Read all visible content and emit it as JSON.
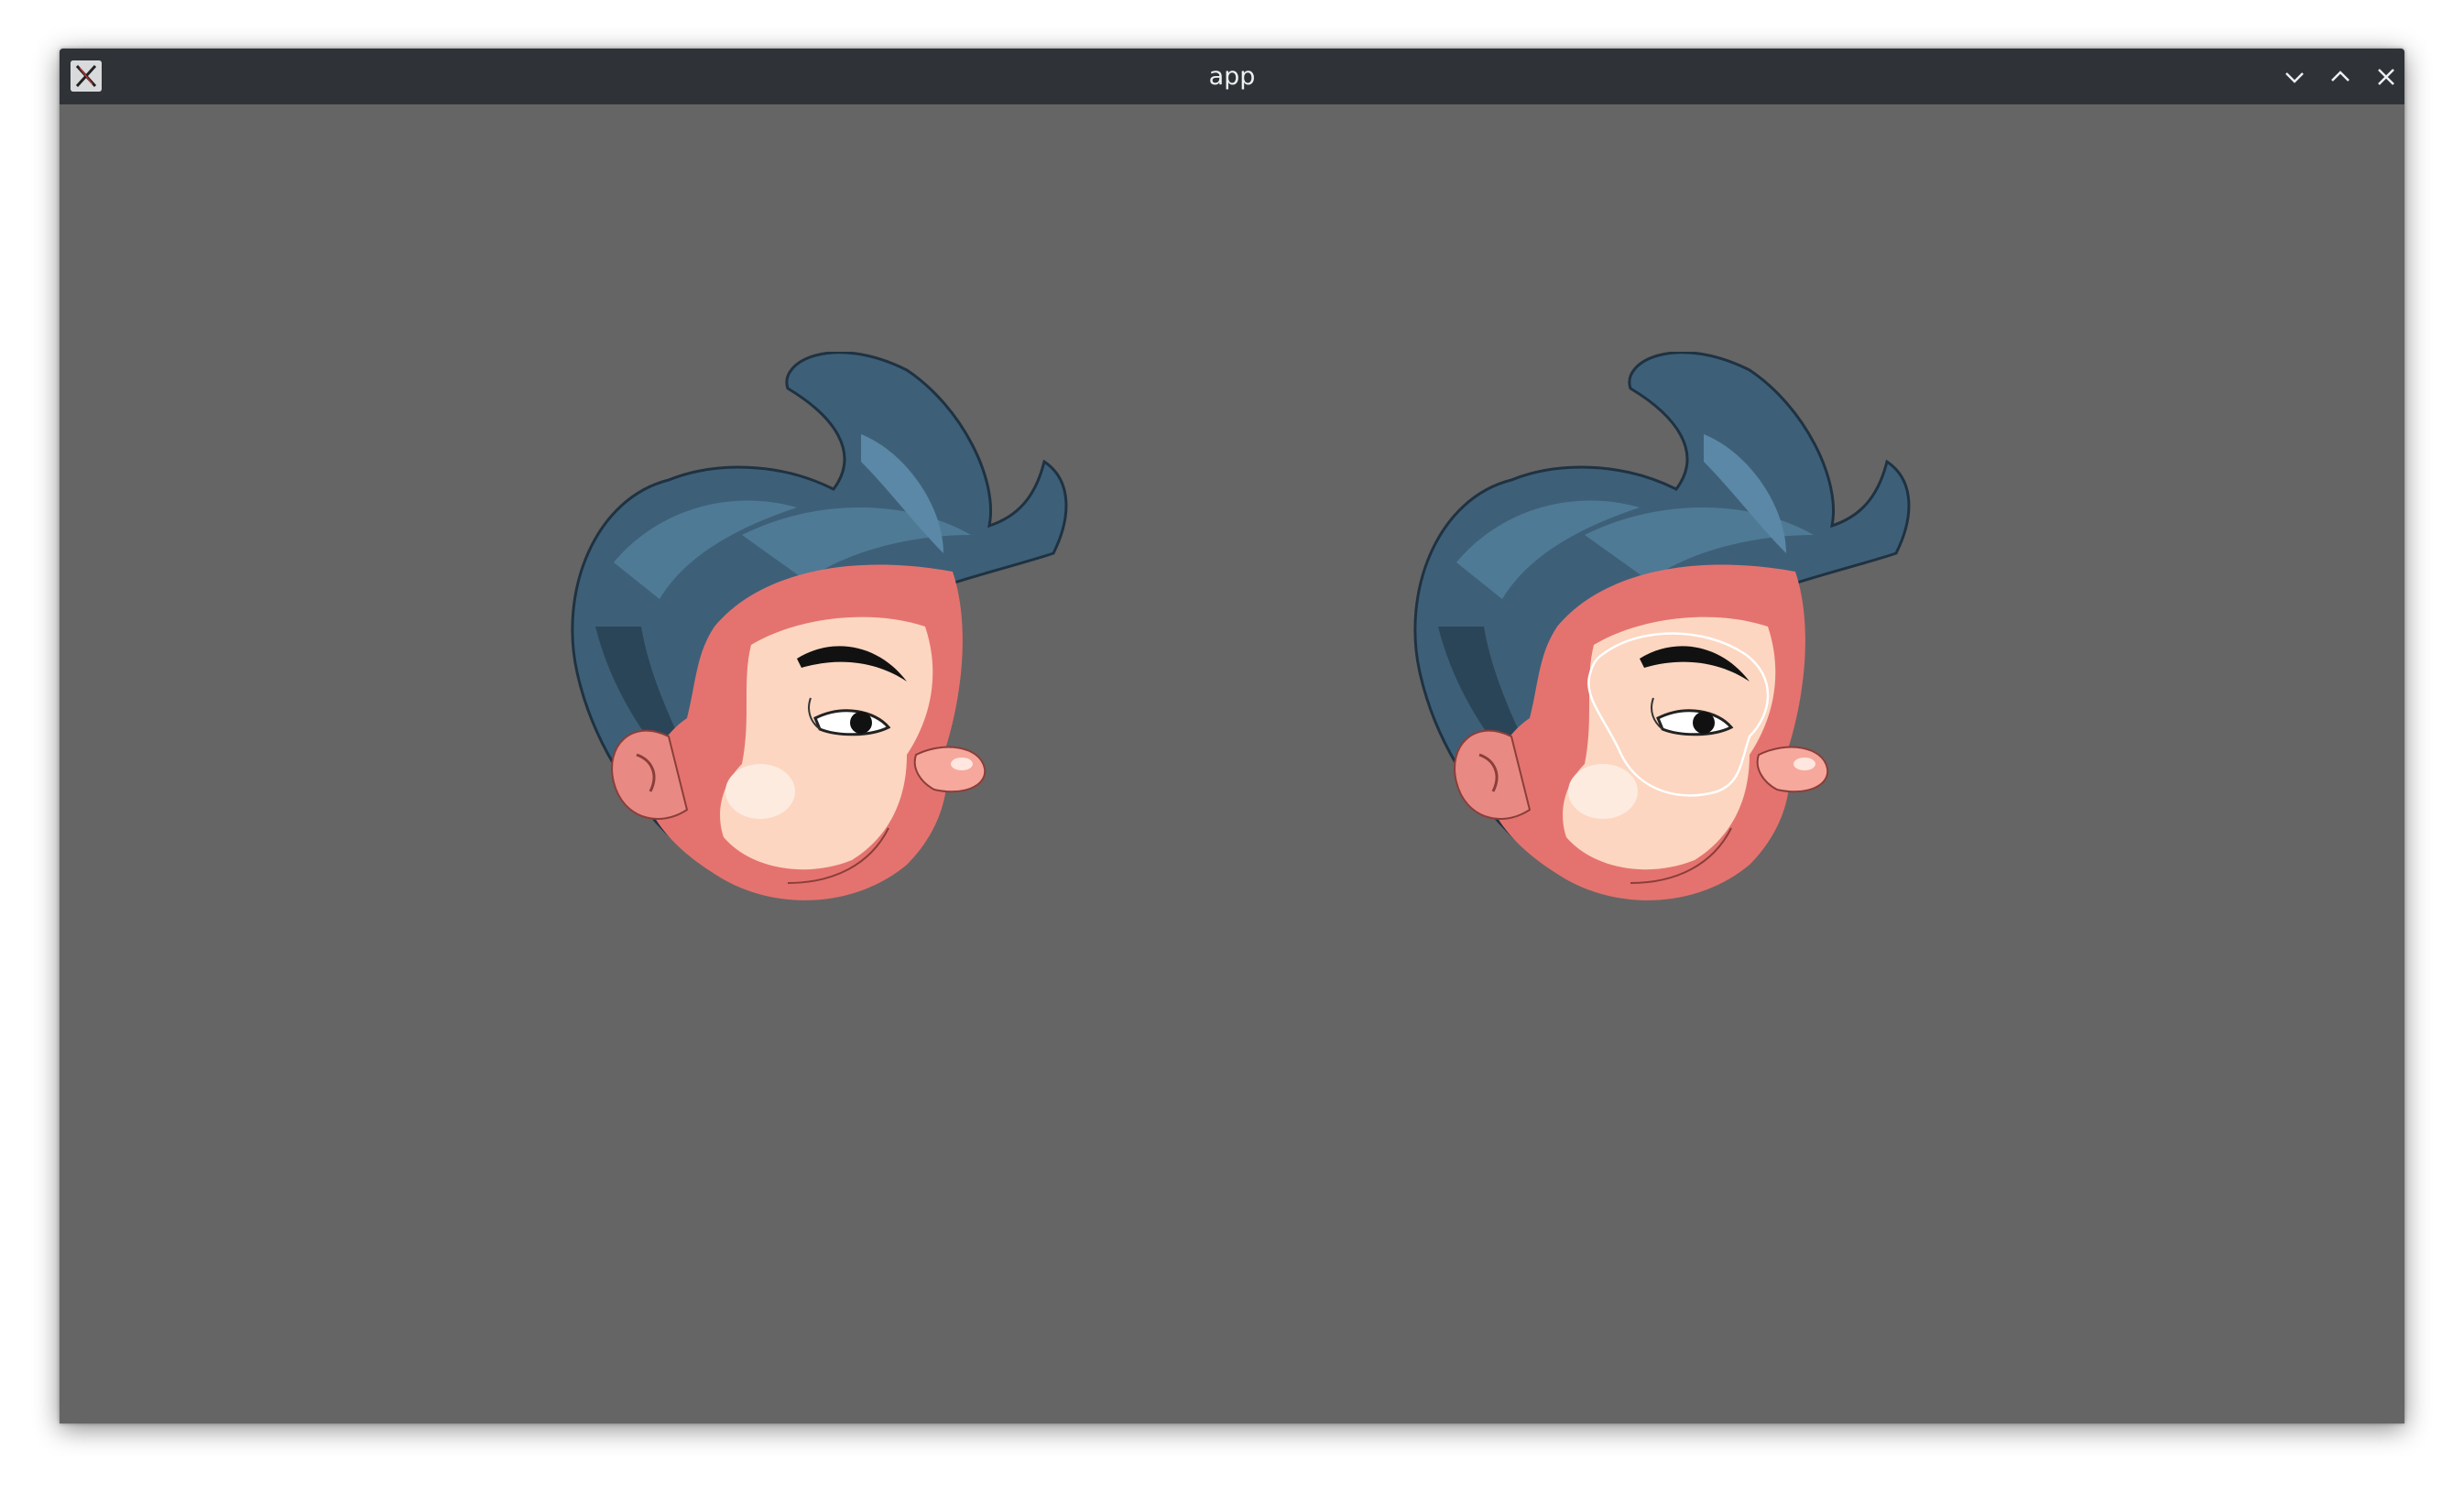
{
  "window": {
    "title": "app",
    "background": "#656565",
    "titlebar_color": "#2f3338",
    "icons": {
      "app": "x11-app-icon",
      "minimize": "chevron-down-icon",
      "maximize": "chevron-up-icon",
      "close": "close-icon"
    }
  },
  "canvas": {
    "sprites": [
      {
        "name": "cartoon-head",
        "outline_highlight": false
      },
      {
        "name": "cartoon-head",
        "outline_highlight": true
      }
    ],
    "colors": {
      "hair": "#3d6078",
      "hair_dark": "#2b4558",
      "skin": "#fcd6c0",
      "skin_shadow": "#e4736f",
      "highlight_outline": "#ffffff"
    }
  }
}
